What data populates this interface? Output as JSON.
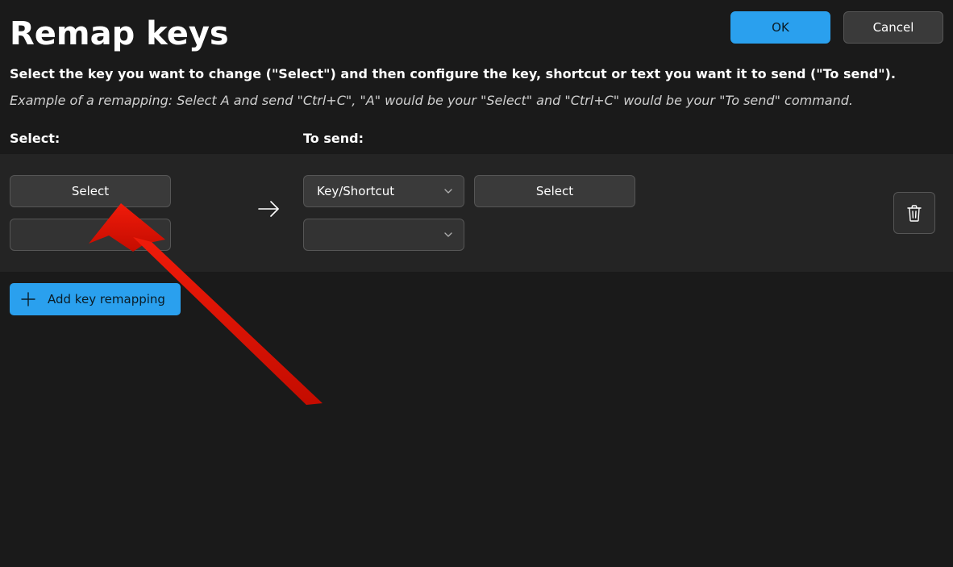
{
  "colors": {
    "accent": "#2aa0ee",
    "danger_arrow": "#f01b0a"
  },
  "header": {
    "title": "Remap keys",
    "ok_label": "OK",
    "cancel_label": "Cancel"
  },
  "intro": {
    "line1": "Select the key you want to change (\"Select\") and then configure the key, shortcut or text you want it to send (\"To send\").",
    "line2": "Example of a remapping: Select A and send \"Ctrl+C\", \"A\" would be your \"Select\" and \"Ctrl+C\" would be your \"To send\" command."
  },
  "columns": {
    "select_label": "Select:",
    "to_send_label": "To send:"
  },
  "row": {
    "select_button": "Select",
    "select_key_value": "",
    "send_type_value": "Key/Shortcut",
    "send_select_button": "Select",
    "send_key_value": ""
  },
  "add_button": "Add key remapping",
  "icons": {
    "arrow_right": "arrow-right-icon",
    "chevron_down": "chevron-down-icon",
    "trash": "trash-icon",
    "plus": "plus-icon"
  }
}
